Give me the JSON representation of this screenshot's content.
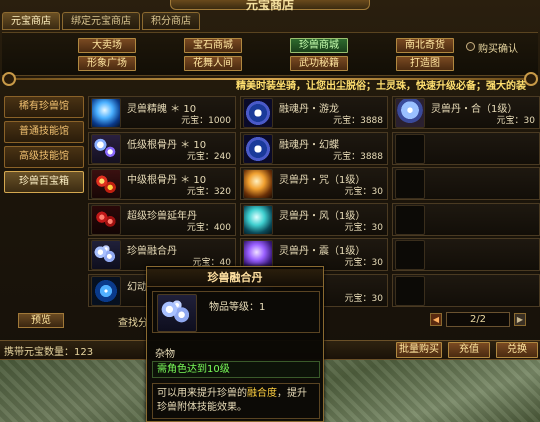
{
  "window": {
    "title": "元宝商店"
  },
  "tabs": [
    {
      "label": "元宝商店",
      "active": true
    },
    {
      "label": "绑定元宝商店",
      "active": false
    },
    {
      "label": "积分商店",
      "active": false
    }
  ],
  "categories": [
    {
      "label": "大卖场",
      "active": false
    },
    {
      "label": "宝石商城",
      "active": false
    },
    {
      "label": "珍兽商城",
      "active": true
    },
    {
      "label": "南北奇货",
      "active": false
    },
    {
      "label": "形象广场",
      "active": false
    },
    {
      "label": "花舞人间",
      "active": false
    },
    {
      "label": "武功秘籍",
      "active": false
    },
    {
      "label": "打造图",
      "active": false
    }
  ],
  "purchase_confirm": {
    "label": "购买确认",
    "checked": false
  },
  "marquee": "精美时装坐骑，让您出尘脱俗；土灵珠，快速升级必备；强大的装",
  "sidebar": {
    "items": [
      {
        "label": "稀有珍兽馆",
        "active": false
      },
      {
        "label": "普通技能馆",
        "active": false
      },
      {
        "label": "高级技能馆",
        "active": false
      },
      {
        "label": "珍兽百宝箱",
        "active": true
      }
    ],
    "preview_label": "预览"
  },
  "items": [
    {
      "name": "灵兽精魄 ＊ 10",
      "price": "元宝：1000",
      "icon": "blue-orb-icon"
    },
    {
      "name": "融魂丹・游龙",
      "price": "元宝：3888",
      "icon": "yinyang-icon"
    },
    {
      "name": "灵兽丹・合（1级）",
      "price": "元宝：30",
      "icon": "crystal-ball-icon"
    },
    {
      "name": "低级根骨丹 ＊ 10",
      "price": "元宝：240",
      "icon": "pills-icon"
    },
    {
      "name": "融魂丹・幻蝶",
      "price": "元宝：3888",
      "icon": "yinyang-icon"
    },
    {
      "name": "",
      "price": "",
      "icon": ""
    },
    {
      "name": "中级根骨丹 ＊ 10",
      "price": "元宝：320",
      "icon": "red-pills-icon"
    },
    {
      "name": "灵兽丹・咒（1级）",
      "price": "元宝：30",
      "icon": "gold-orb-icon"
    },
    {
      "name": "",
      "price": "",
      "icon": ""
    },
    {
      "name": "超级珍兽延年丹",
      "price": "元宝：400",
      "icon": "red-berries-icon"
    },
    {
      "name": "灵兽丹・风（1级）",
      "price": "元宝：30",
      "icon": "teal-orb-icon"
    },
    {
      "name": "",
      "price": "",
      "icon": ""
    },
    {
      "name": "珍兽融合丹",
      "price": "元宝：40",
      "icon": "swirl-orbs-icon"
    },
    {
      "name": "灵兽丹・震（1级）",
      "price": "元宝：30",
      "icon": "purple-orb-icon"
    },
    {
      "name": "",
      "price": "",
      "icon": ""
    },
    {
      "name": "幻动",
      "price": "",
      "icon": "blue-sparkle-icon"
    },
    {
      "name": "",
      "price": "元宝：30",
      "icon": "dark-orb-icon"
    },
    {
      "name": "",
      "price": "",
      "icon": ""
    }
  ],
  "search_label": "查找分",
  "pager": {
    "prev": "◀",
    "value": "2/2",
    "next": "▶"
  },
  "wallet": {
    "label": "携带元宝数量：123"
  },
  "buttons": {
    "bulk": "批量购买",
    "recharge": "充值",
    "exchange": "兑换"
  },
  "tooltip": {
    "title": "珍兽融合丹",
    "level": "物品等级：1",
    "kind": "杂物",
    "requirement": "需角色达到10级",
    "desc_pre": "可以用来提升珍兽的",
    "desc_hl": "融合度",
    "desc_post": "，提升珍兽附体技能效果。"
  },
  "colors": {
    "gold": "#ffe070",
    "req_green": "#7aff5a",
    "active_cat": "#2e6a2e",
    "button_brown": "#7a4a22"
  }
}
